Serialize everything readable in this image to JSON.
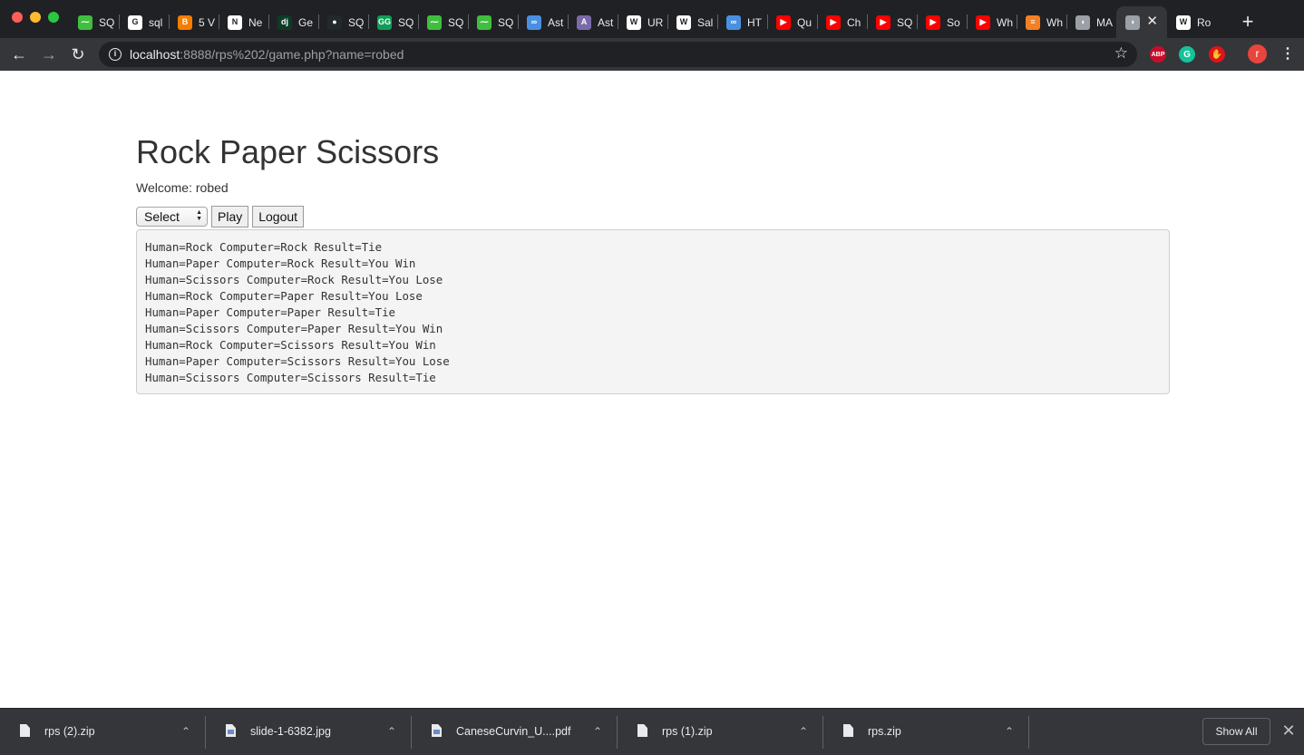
{
  "tabs": [
    {
      "title": "SQ",
      "icon": "chart-icon",
      "color": "#3fbf3f",
      "glyph": "⁓"
    },
    {
      "title": "sql",
      "icon": "google-icon",
      "color": "#ffffff",
      "glyph": "G"
    },
    {
      "title": "5 V",
      "icon": "blogger-icon",
      "color": "#f57d00",
      "glyph": "B"
    },
    {
      "title": "Ne",
      "icon": "newsletter-icon",
      "color": "#ffffff",
      "glyph": "N"
    },
    {
      "title": "Ge",
      "icon": "django-icon",
      "color": "#0c3c26",
      "glyph": "dj"
    },
    {
      "title": "SQ",
      "icon": "github-icon",
      "color": "#24292e",
      "glyph": "●"
    },
    {
      "title": "SQ",
      "icon": "geeksforgeeks-icon",
      "color": "#0f9d58",
      "glyph": "GG"
    },
    {
      "title": "SQ",
      "icon": "chart-icon",
      "color": "#3fbf3f",
      "glyph": "⁓"
    },
    {
      "title": "SQ",
      "icon": "chart-icon",
      "color": "#3fbf3f",
      "glyph": "⁓"
    },
    {
      "title": "Ast",
      "icon": "infinity-icon",
      "color": "#4a90e2",
      "glyph": "∞"
    },
    {
      "title": "Ast",
      "icon": "avatar-icon",
      "color": "#7a6aa8",
      "glyph": "A"
    },
    {
      "title": "UR",
      "icon": "wikipedia-icon",
      "color": "#ffffff",
      "glyph": "W"
    },
    {
      "title": "Sal",
      "icon": "wikipedia-icon",
      "color": "#ffffff",
      "glyph": "W"
    },
    {
      "title": "HT",
      "icon": "infinity-icon",
      "color": "#4a90e2",
      "glyph": "∞"
    },
    {
      "title": "Qu",
      "icon": "youtube-icon",
      "color": "#ff0000",
      "glyph": "▶"
    },
    {
      "title": "Ch",
      "icon": "youtube-icon",
      "color": "#ff0000",
      "glyph": "▶"
    },
    {
      "title": "SQ",
      "icon": "youtube-icon",
      "color": "#ff0000",
      "glyph": "▶"
    },
    {
      "title": "So",
      "icon": "youtube-icon",
      "color": "#ff0000",
      "glyph": "▶"
    },
    {
      "title": "Wh",
      "icon": "youtube-icon",
      "color": "#ff0000",
      "glyph": "▶"
    },
    {
      "title": "Wh",
      "icon": "stackoverflow-icon",
      "color": "#f48024",
      "glyph": "≡"
    },
    {
      "title": "MA",
      "icon": "elephant-icon",
      "color": "#9aa0a6",
      "glyph": "◖"
    },
    {
      "title": "",
      "icon": "elephant-icon",
      "color": "#9aa0a6",
      "glyph": "◖",
      "active": true
    },
    {
      "title": "Ro",
      "icon": "wikipedia-icon",
      "color": "#ffffff",
      "glyph": "W"
    }
  ],
  "toolbar": {
    "url_host": "localhost",
    "url_rest": ":8888/rps%202/game.php?name=robed",
    "avatar_letter": "r",
    "ext_abp": "ABP",
    "ext_grammarly": "G",
    "ext_hand": "✋"
  },
  "page": {
    "title": "Rock Paper Scissors",
    "welcome": "Welcome: robed",
    "select_value": "Select",
    "play_label": "Play",
    "logout_label": "Logout",
    "results": [
      "Human=Rock Computer=Rock Result=Tie",
      "Human=Paper Computer=Rock Result=You Win",
      "Human=Scissors Computer=Rock Result=You Lose",
      "Human=Rock Computer=Paper Result=You Lose",
      "Human=Paper Computer=Paper Result=Tie",
      "Human=Scissors Computer=Paper Result=You Win",
      "Human=Rock Computer=Scissors Result=You Win",
      "Human=Paper Computer=Scissors Result=You Lose",
      "Human=Scissors Computer=Scissors Result=Tie"
    ]
  },
  "downloads": {
    "items": [
      {
        "name": "rps (2).zip",
        "type": "zip"
      },
      {
        "name": "slide-1-6382.jpg",
        "type": "image"
      },
      {
        "name": "CaneseCurvin_U....pdf",
        "type": "pdf"
      },
      {
        "name": "rps (1).zip",
        "type": "zip"
      },
      {
        "name": "rps.zip",
        "type": "zip"
      }
    ],
    "show_all_label": "Show All"
  }
}
